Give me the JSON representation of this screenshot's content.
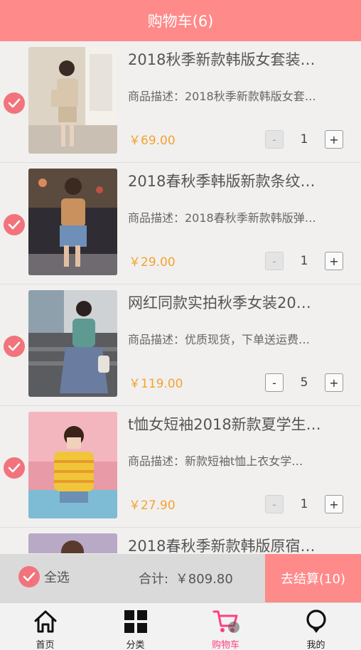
{
  "header": {
    "title": "购物车(6)"
  },
  "items": [
    {
      "title": "2018秋季新款韩版女套装…",
      "desc": "商品描述：2018秋季新款韩版女套…",
      "price": "￥69.00",
      "qty": "1",
      "minus": "-",
      "plus": "+"
    },
    {
      "title": "2018春秋季韩版新款条纹…",
      "desc": "商品描述：2018春秋季新款韩版弹…",
      "price": "￥29.00",
      "qty": "1",
      "minus": "-",
      "plus": "+"
    },
    {
      "title": "网红同款实拍秋季女装20…",
      "desc": "商品描述：优质现货，下单送运费…",
      "price": "￥119.00",
      "qty": "5",
      "minus": "-",
      "plus": "+"
    },
    {
      "title": "t恤女短袖2018新款夏学生…",
      "desc": "商品描述：新款短袖t恤上衣女学…",
      "price": "￥27.90",
      "qty": "1",
      "minus": "-",
      "plus": "+"
    },
    {
      "title": "2018春秋季新款韩版原宿…"
    }
  ],
  "footer": {
    "select_all": "全选",
    "total_label": "合计:",
    "total_value": "￥809.80",
    "checkout": "去结算(10)"
  },
  "tabs": [
    {
      "label": "首页",
      "icon": "home-icon"
    },
    {
      "label": "分类",
      "icon": "category-grid-icon"
    },
    {
      "label": "购物车",
      "icon": "cart-icon",
      "active": true
    },
    {
      "label": "我的",
      "icon": "profile-icon"
    }
  ],
  "colors": {
    "accent": "#ff8a8a",
    "price": "#f4a233",
    "active_tab": "#ff3f7f",
    "check": "#f2737c"
  }
}
